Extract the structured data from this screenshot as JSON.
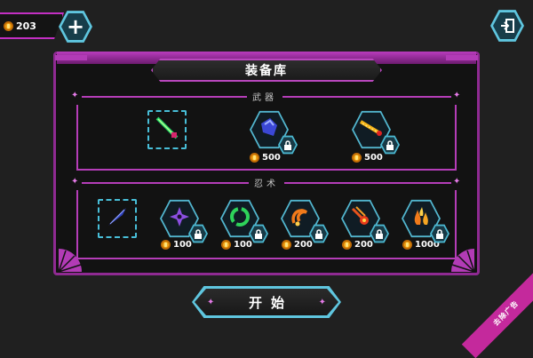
{
  "header": {
    "coins": "203",
    "add_icon": "plus-icon",
    "exit_icon": "exit-icon"
  },
  "panel": {
    "title": "装备库"
  },
  "weapons": {
    "label": "武器",
    "items": [
      {
        "name": "green-sword",
        "locked": false,
        "price": ""
      },
      {
        "name": "blue-gauntlet",
        "locked": true,
        "price": "500"
      },
      {
        "name": "flame-blade",
        "locked": true,
        "price": "500"
      }
    ]
  },
  "ninjutsu": {
    "label": "忍术",
    "items": [
      {
        "name": "kunai",
        "locked": false,
        "price": ""
      },
      {
        "name": "shuriken",
        "locked": true,
        "price": "100"
      },
      {
        "name": "green-ring",
        "locked": true,
        "price": "100"
      },
      {
        "name": "fire-swirl",
        "locked": true,
        "price": "200"
      },
      {
        "name": "fireballs",
        "locked": true,
        "price": "200"
      },
      {
        "name": "flames",
        "locked": true,
        "price": "1000"
      }
    ]
  },
  "start_button": {
    "label": "开始"
  },
  "corner": {
    "label": "去除广告"
  },
  "colors": {
    "accent": "#b53db8",
    "cyan": "#5fc6df",
    "coin": "#f1a516"
  }
}
